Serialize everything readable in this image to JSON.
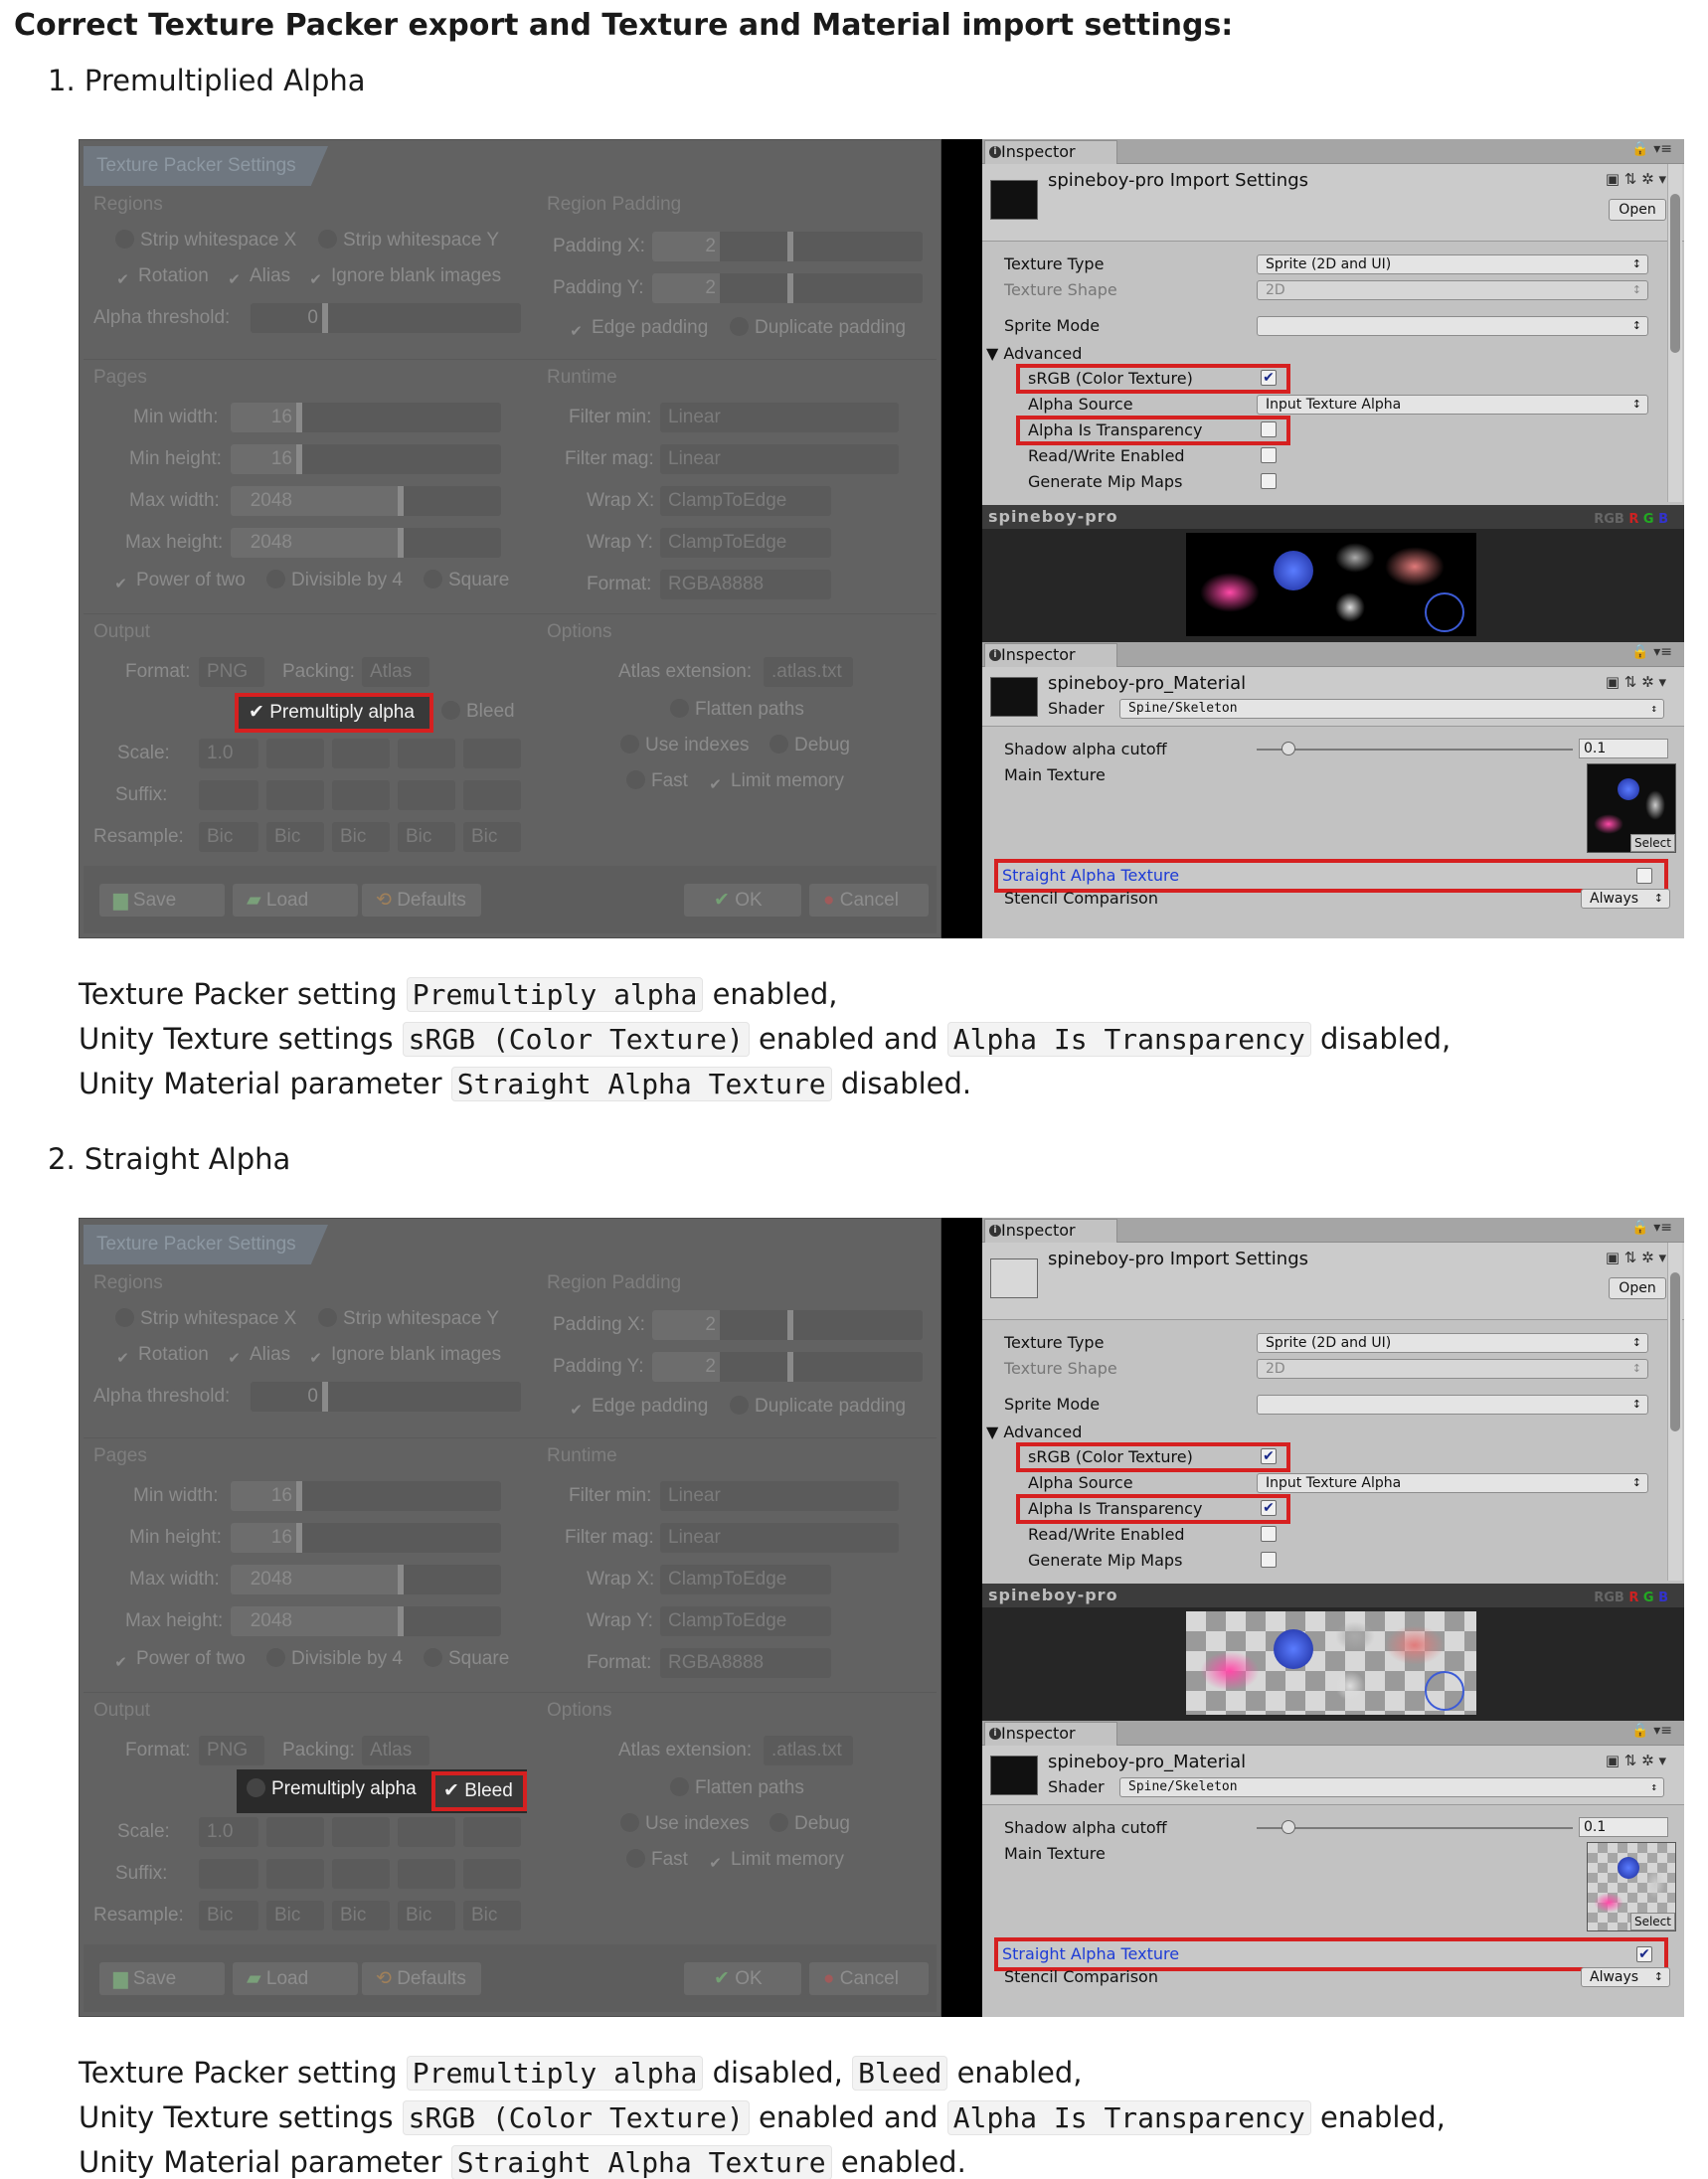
{
  "title": "Correct Texture Packer export and Texture and Material import settings:",
  "sections": [
    {
      "heading": "1. Premultiplied Alpha",
      "tp_premultiply_checked": true,
      "tp_bleed_checked": false,
      "unity": {
        "import_settings_title": "spineboy-pro Import Settings",
        "srgb_checked": true,
        "alpha_is_transparency_checked": false,
        "straight_alpha_checked": false,
        "preview_style": "black"
      },
      "description": [
        [
          {
            "t": "Texture Packer setting "
          },
          {
            "c": "Premultiply alpha"
          },
          {
            "t": " enabled,"
          }
        ],
        [
          {
            "t": "Unity Texture settings "
          },
          {
            "c": "sRGB (Color Texture)"
          },
          {
            "t": " enabled and "
          },
          {
            "c": "Alpha Is Transparency"
          },
          {
            "t": " disabled,"
          }
        ],
        [
          {
            "t": "Unity Material parameter "
          },
          {
            "c": "Straight Alpha Texture"
          },
          {
            "t": " disabled."
          }
        ]
      ]
    },
    {
      "heading": "2. Straight Alpha",
      "tp_premultiply_checked": false,
      "tp_bleed_checked": true,
      "unity": {
        "import_settings_title": "spineboy-pro Import Settings",
        "srgb_checked": true,
        "alpha_is_transparency_checked": true,
        "straight_alpha_checked": true,
        "preview_style": "checker"
      },
      "description": [
        [
          {
            "t": "Texture Packer setting "
          },
          {
            "c": "Premultiply alpha"
          },
          {
            "t": " disabled, "
          },
          {
            "c": "Bleed"
          },
          {
            "t": " enabled,"
          }
        ],
        [
          {
            "t": "Unity Texture settings "
          },
          {
            "c": "sRGB (Color Texture)"
          },
          {
            "t": " enabled and "
          },
          {
            "c": "Alpha Is Transparency"
          },
          {
            "t": " enabled,"
          }
        ],
        [
          {
            "t": "Unity Material parameter "
          },
          {
            "c": "Straight Alpha Texture"
          },
          {
            "t": " enabled."
          }
        ]
      ]
    }
  ],
  "texture_packer": {
    "window_title": "Texture Packer Settings",
    "regions": {
      "heading": "Regions",
      "strip_x": "Strip whitespace X",
      "strip_y": "Strip whitespace Y",
      "rotation": "Rotation",
      "alias": "Alias",
      "ignore_blank": "Ignore blank images",
      "alpha_threshold_label": "Alpha threshold:",
      "alpha_threshold_value": "0"
    },
    "region_padding": {
      "heading": "Region Padding",
      "padding_x_label": "Padding X:",
      "padding_x_value": "2",
      "padding_y_label": "Padding Y:",
      "padding_y_value": "2",
      "edge_padding": "Edge padding",
      "duplicate_padding": "Duplicate padding"
    },
    "pages": {
      "heading": "Pages",
      "min_width_label": "Min width:",
      "min_width_value": "16",
      "min_height_label": "Min height:",
      "min_height_value": "16",
      "max_width_label": "Max width:",
      "max_width_value": "2048",
      "max_height_label": "Max height:",
      "max_height_value": "2048",
      "power_of_two": "Power of two",
      "divisible_by_4": "Divisible by 4",
      "square": "Square"
    },
    "runtime": {
      "heading": "Runtime",
      "filter_min_label": "Filter min:",
      "filter_min_value": "Linear",
      "filter_mag_label": "Filter mag:",
      "filter_mag_value": "Linear",
      "wrap_x_label": "Wrap X:",
      "wrap_x_value": "ClampToEdge",
      "wrap_y_label": "Wrap Y:",
      "wrap_y_value": "ClampToEdge",
      "format_label": "Format:",
      "format_value": "RGBA8888"
    },
    "output": {
      "heading": "Output",
      "format_label": "Format:",
      "format_value": "PNG",
      "packing_label": "Packing:",
      "packing_value": "Atlas",
      "premultiply_alpha": "Premultiply alpha",
      "bleed": "Bleed",
      "scale_label": "Scale:",
      "scale_value": "1.0",
      "suffix_label": "Suffix:",
      "resample_label": "Resample:",
      "resample_value": "Bic"
    },
    "options": {
      "heading": "Options",
      "atlas_extension_label": "Atlas extension:",
      "atlas_extension_value": ".atlas.txt",
      "flatten_paths": "Flatten paths",
      "use_indexes": "Use indexes",
      "debug": "Debug",
      "fast": "Fast",
      "limit_memory": "Limit memory"
    },
    "buttons": {
      "save": "Save",
      "load": "Load",
      "defaults": "Defaults",
      "ok": "OK",
      "cancel": "Cancel"
    }
  },
  "unity_common": {
    "inspector_tab": "Inspector",
    "open_button": "Open",
    "texture_type_label": "Texture Type",
    "texture_type_value": "Sprite (2D and UI)",
    "texture_shape_label": "Texture Shape",
    "texture_shape_value": "2D",
    "sprite_mode_label": "Sprite Mode",
    "advanced_label": "Advanced",
    "srgb_label": "sRGB (Color Texture)",
    "alpha_source_label": "Alpha Source",
    "alpha_source_value": "Input Texture Alpha",
    "alpha_is_transparency_label": "Alpha Is Transparency",
    "read_write_label": "Read/Write Enabled",
    "mip_maps_label": "Generate Mip Maps",
    "preview_name": "spineboy-pro",
    "preview_channels": "RGB",
    "material_name": "spineboy-pro_Material",
    "shader_label": "Shader",
    "shader_value": "Spine/Skeleton",
    "shadow_cutoff_label": "Shadow alpha cutoff",
    "shadow_cutoff_value": "0.1",
    "shadow_cutoff_level": 0.1,
    "main_texture_label": "Main Texture",
    "select_button": "Select",
    "straight_alpha_label": "Straight Alpha Texture",
    "stencil_label": "Stencil Comparison",
    "stencil_value": "Always"
  }
}
